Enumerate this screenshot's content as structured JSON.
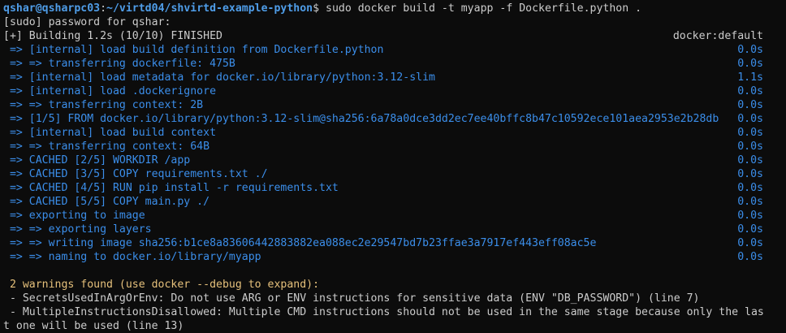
{
  "prompt": {
    "user_host": "qshar@qsharpc03",
    "sep": ":",
    "path": "~/virtd04/shvirtd-example-python",
    "dollar": "$ ",
    "command": "sudo docker build -t myapp -f Dockerfile.python ."
  },
  "sudo_prompt": "[sudo] password for qshar:",
  "build_header": {
    "text": "[+] Building 1.2s (10/10) FINISHED",
    "driver": "docker:default"
  },
  "steps": [
    {
      "text": " => [internal] load build definition from Dockerfile.python",
      "time": "0.0s"
    },
    {
      "text": " => => transferring dockerfile: 475B",
      "time": "0.0s"
    },
    {
      "text": " => [internal] load metadata for docker.io/library/python:3.12-slim",
      "time": "1.1s"
    },
    {
      "text": " => [internal] load .dockerignore",
      "time": "0.0s"
    },
    {
      "text": " => => transferring context: 2B",
      "time": "0.0s"
    },
    {
      "text": " => [1/5] FROM docker.io/library/python:3.12-slim@sha256:6a78a0dce3dd2ec7ee40bffc8b47c10592ece101aea2953e2b28db",
      "time": "0.0s"
    },
    {
      "text": " => [internal] load build context",
      "time": "0.0s"
    },
    {
      "text": " => => transferring context: 64B",
      "time": "0.0s"
    },
    {
      "text": " => CACHED [2/5] WORKDIR /app",
      "time": "0.0s"
    },
    {
      "text": " => CACHED [3/5] COPY requirements.txt ./",
      "time": "0.0s"
    },
    {
      "text": " => CACHED [4/5] RUN pip install -r requirements.txt",
      "time": "0.0s"
    },
    {
      "text": " => CACHED [5/5] COPY main.py ./",
      "time": "0.0s"
    },
    {
      "text": " => exporting to image",
      "time": "0.0s"
    },
    {
      "text": " => => exporting layers",
      "time": "0.0s"
    },
    {
      "text": " => => writing image sha256:b1ce8a83606442883882ea088ec2e29547bd7b23ffae3a7917ef443eff08ac5e",
      "time": "0.0s"
    },
    {
      "text": " => => naming to docker.io/library/myapp",
      "time": "0.0s"
    }
  ],
  "warnings": {
    "header": " 2 warnings found (use docker --debug to expand):",
    "lines": [
      " - SecretsUsedInArgOrEnv: Do not use ARG or ENV instructions for sensitive data (ENV \"DB_PASSWORD\") (line 7)",
      " - MultipleInstructionsDisallowed: Multiple CMD instructions should not be used in the same stage because only the las",
      "t one will be used (line 13)"
    ]
  },
  "colors": {
    "background": "#0c0c0c",
    "text": "#cccccc",
    "prompt": "#4f9de8",
    "step": "#3b8eea",
    "warning": "#e5c07b"
  }
}
